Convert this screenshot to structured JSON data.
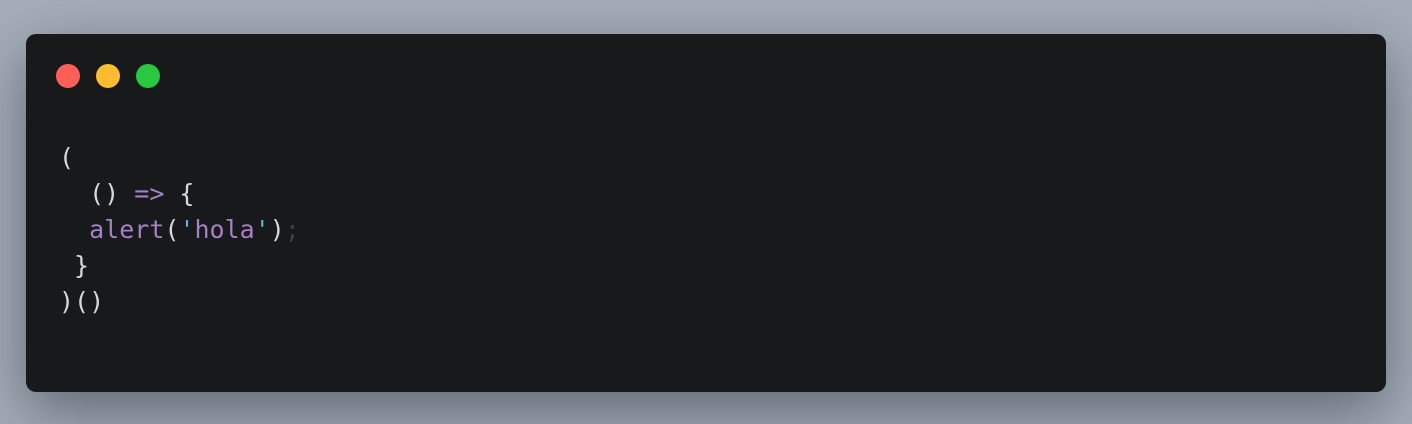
{
  "window": {
    "controls": [
      {
        "name": "close",
        "color": "#ff5f57"
      },
      {
        "name": "minimize",
        "color": "#febc2e"
      },
      {
        "name": "maximize",
        "color": "#28c840"
      }
    ],
    "background": "#18191b"
  },
  "code": {
    "lines": [
      [
        {
          "t": "(",
          "c": "plain"
        }
      ],
      [
        {
          "t": "  () ",
          "c": "plain"
        },
        {
          "t": "=>",
          "c": "arrow"
        },
        {
          "t": " {",
          "c": "plain"
        }
      ],
      [
        {
          "t": "  ",
          "c": "plain"
        },
        {
          "t": "alert",
          "c": "fn"
        },
        {
          "t": "(",
          "c": "plain"
        },
        {
          "t": "'",
          "c": "q"
        },
        {
          "t": "hola",
          "c": "str"
        },
        {
          "t": "'",
          "c": "q"
        },
        {
          "t": ")",
          "c": "plain"
        },
        {
          "t": ";",
          "c": "semi"
        }
      ],
      [
        {
          "t": " }",
          "c": "plain"
        }
      ],
      [
        {
          "t": ")()",
          "c": "plain"
        }
      ]
    ]
  }
}
